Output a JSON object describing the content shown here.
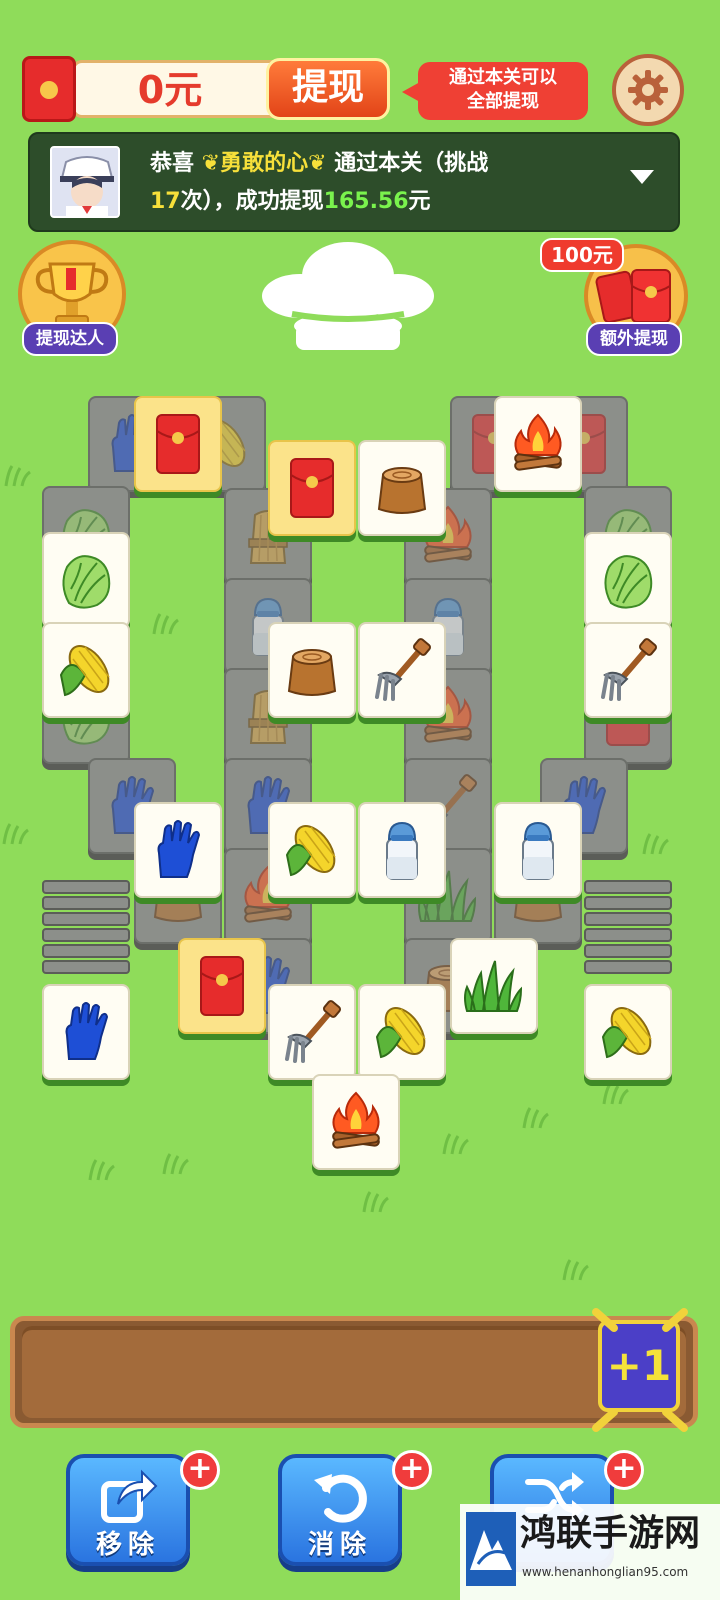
{
  "top_bar": {
    "balance": "0元",
    "withdraw_label": "提现",
    "tip_line1": "通过本关可以",
    "tip_line2": "全部提现",
    "settings_icon": "gear-icon"
  },
  "notice": {
    "prefix": "恭喜",
    "name": "勇敢的心",
    "middle": "通过本关（挑战",
    "attempts": "17",
    "attempts_suffix": "次），成功提现",
    "amount": "165.56",
    "amount_suffix": "元"
  },
  "side": {
    "trophy_label": "提现达人",
    "extra_badge": "100元",
    "extra_label": "额外提现"
  },
  "tray": {
    "plus_one_label": "+1"
  },
  "tools": {
    "remove_label": "移除",
    "undo_label": "消除",
    "shuffle_label": "",
    "plus": "+"
  },
  "watermark": {
    "title": "鸿联手游网",
    "url": "www.henanhonglian95.com"
  },
  "colors": {
    "background": "#8fdc5a",
    "accent_red": "#e53b2c",
    "tool_blue": "#2a74e0",
    "tray_brown": "#8a5a32"
  }
}
